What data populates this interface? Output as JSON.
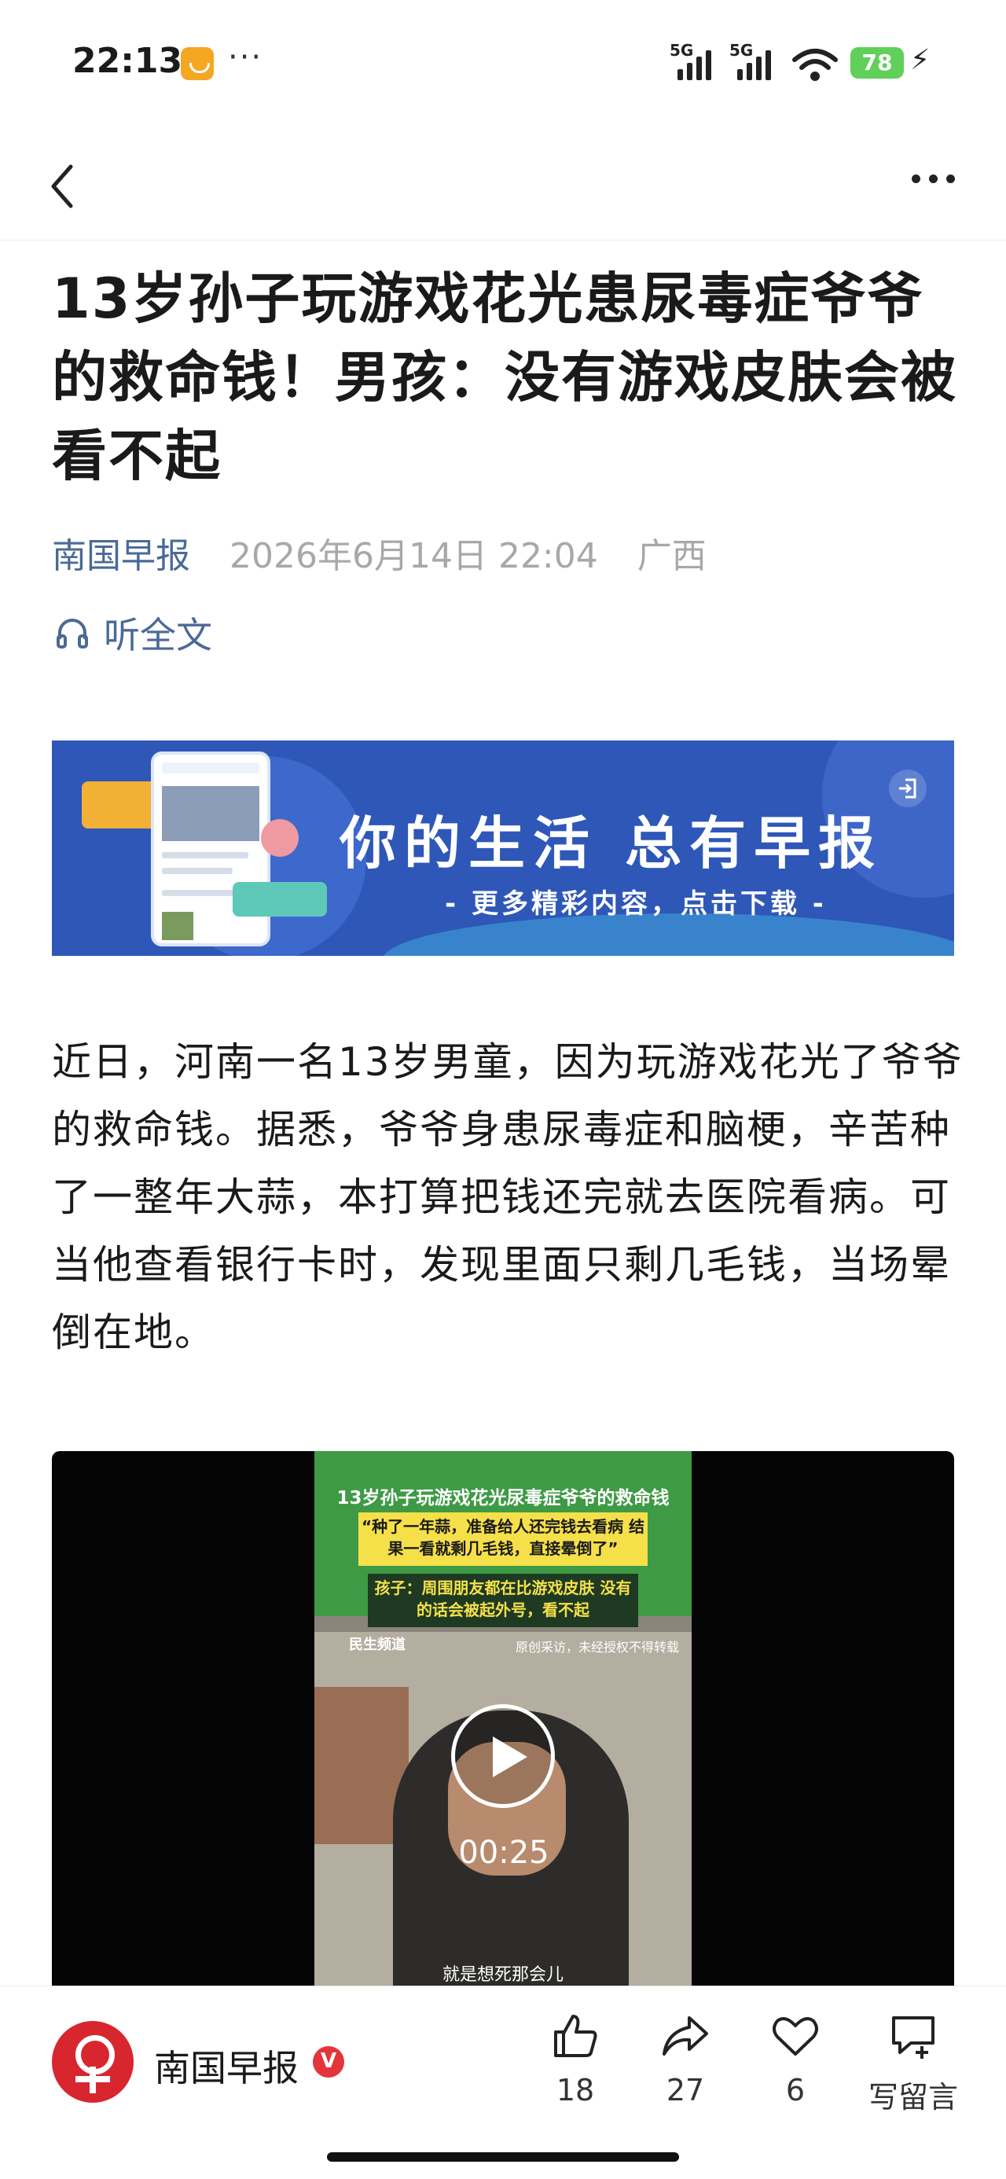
{
  "status_bar": {
    "time": "22:13",
    "dots": "···",
    "signal1_label": "5G",
    "signal2_label": "5G",
    "battery": "78",
    "bolt": "⚡"
  },
  "article": {
    "title": "13岁孙子玩游戏花光患尿毒症爷爷的救命钱！男孩：没有游戏皮肤会被看不起",
    "source": "南国早报",
    "date": "2026年6月14日 22:04",
    "location": "广西",
    "listen_label": "听全文",
    "paragraph": "近日，河南一名13岁男童，因为玩游戏花光了爷爷的救命钱。据悉，爷爷身患尿毒症和脑梗，辛苦种了一整年大蒜，本打算把钱还完就去医院看病。可当他查看银行卡时，发现里面只剩几毛钱，当场晕倒在地。"
  },
  "banner": {
    "headline": "你的生活  总有早报",
    "subline": "- 更多精彩内容，点击下载 -"
  },
  "video": {
    "caption_title": "13岁孙子玩游戏花光尿毒症爷爷的救命钱",
    "caption_quote": "“种了一年蒜，准备给人还完钱去看病 结果一看就剩几毛钱，直接晕倒了”",
    "caption_child": "孩子：周围朋友都在比游戏皮肤 没有的话会被起外号，看不起",
    "logo_text": "民生频道",
    "credit_text": "原创采访，未经授权不得转载",
    "subtitle": "就是想死那会儿",
    "duration": "00:25"
  },
  "bottom_bar": {
    "publisher": "南国早报",
    "verified": "V",
    "like_count": "18",
    "share_count": "27",
    "favorite_count": "6",
    "comment_label": "写留言"
  },
  "colors": {
    "link_blue": "#4a6a96",
    "banner_blue": "#2e57b8",
    "brand_red": "#d8262f",
    "battery_green": "#5fd05a"
  },
  "icons": [
    "back-icon",
    "more-icon",
    "headphones-icon",
    "exit-icon",
    "play-icon",
    "thumbs-up-icon",
    "share-icon",
    "heart-icon",
    "comment-icon"
  ]
}
